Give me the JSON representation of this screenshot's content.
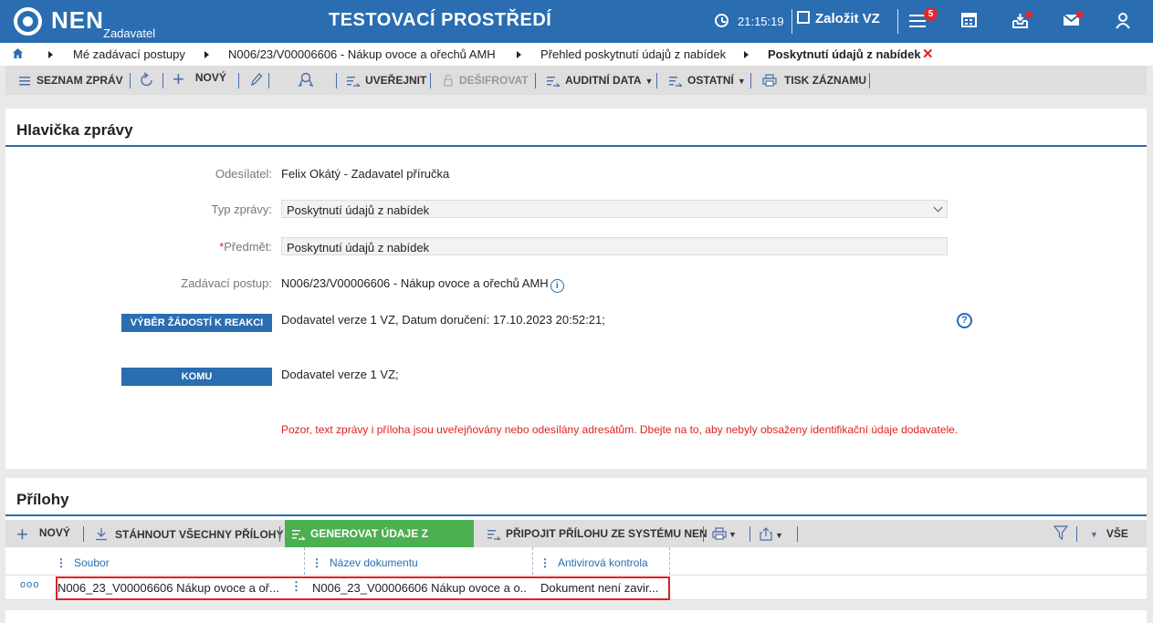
{
  "header": {
    "logo_text": "NEN",
    "logo_sub": "Zadavatel",
    "env_title": "TESTOVACÍ PROSTŘEDÍ",
    "time": "21:15:19",
    "create_label": "Založit VZ",
    "notif_count": "5"
  },
  "breadcrumb": {
    "items": [
      "Mé zadávací postupy",
      "N006/23/V00006606 - Nákup ovoce a ořechů AMH",
      "Přehled poskytnutí údajů z nabídek",
      "Poskytnutí údajů z nabídek"
    ]
  },
  "toolbar": {
    "list": "SEZNAM ZPRÁV",
    "new": "NOVÝ",
    "publish": "UVEŘEJNIT",
    "decrypt": "DEŠIFROVAT",
    "audit": "AUDITNÍ DATA",
    "other": "OSTATNÍ",
    "print": "TISK ZÁZNAMU"
  },
  "header_panel": {
    "title": "Hlavička zprávy",
    "sender_label": "Odesílatel:",
    "sender_value": "Felix Okátý - Zadavatel příručka",
    "type_label": "Typ zprávy:",
    "type_value": "Poskytnutí údajů z nabídek",
    "subject_required": "*",
    "subject_label": "Předmět:",
    "subject_value": "Poskytnutí údajů z nabídek",
    "procedure_label": "Zadávací postup:",
    "procedure_value": "N006/23/V00006606 - Nákup ovoce a ořechů AMH",
    "select_button": "VÝBĚR ŽÁDOSTÍ K REAKCI",
    "select_value": "Dodavatel verze 1 VZ, Datum doručení: 17.10.2023 20:52:21;",
    "to_button": "KOMU",
    "to_value": "Dodavatel verze 1 VZ;",
    "warning": "Pozor, text zprávy i příloha jsou uveřejňovány nebo odesílány adresátům. Dbejte na to, aby nebyly obsaženy identifikační údaje dodavatele."
  },
  "attachments": {
    "title": "Přílohy",
    "new": "NOVÝ",
    "download_all": "STÁHNOUT VŠECHNY PŘÍLOHY",
    "generate": "GENEROVAT ÚDAJE Z NABÍDEK",
    "attach_nen": "PŘIPOJIT PŘÍLOHU ZE SYSTÉMU NEN",
    "filter_all": "VŠE",
    "columns": [
      "Soubor",
      "Název dokumentu",
      "Antivirová kontrola"
    ],
    "rows": [
      {
        "menu": "ooo",
        "file": "N006_23_V00006606 Nákup ovoce a oř...",
        "name": "N006_23_V00006606 Nákup ovoce a o...",
        "antivirus": "Dokument není zavir..."
      }
    ]
  },
  "colors": {
    "brand": "#2a6db1",
    "green": "#4caf50",
    "alert": "#e02020"
  }
}
